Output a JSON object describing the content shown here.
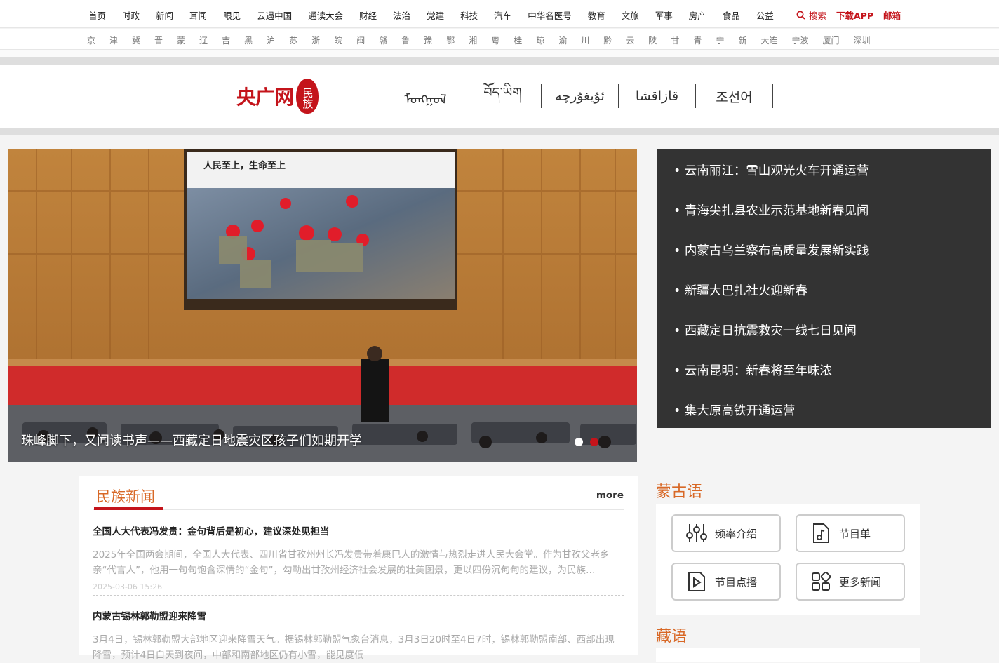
{
  "topnav": {
    "items": [
      "首页",
      "时政",
      "新闻",
      "耳闻",
      "眼见",
      "云遇中国",
      "通读大会",
      "财经",
      "法治",
      "党建",
      "科技",
      "汽车",
      "中华名医号",
      "教育",
      "文旅",
      "军事",
      "房产",
      "食品",
      "公益"
    ],
    "search": "搜索",
    "download": "下载APP",
    "mail": "邮箱"
  },
  "regions": [
    "京",
    "津",
    "冀",
    "晋",
    "蒙",
    "辽",
    "吉",
    "黑",
    "沪",
    "苏",
    "浙",
    "皖",
    "闽",
    "赣",
    "鲁",
    "豫",
    "鄂",
    "湘",
    "粤",
    "桂",
    "琼",
    "渝",
    "川",
    "黔",
    "云",
    "陕",
    "甘",
    "青",
    "宁",
    "新",
    "大连",
    "宁波",
    "厦门",
    "深圳"
  ],
  "brand": {
    "logo_text": "央广网",
    "seal_text": "民族",
    "languages": [
      "ᠮᠣᠩᠭᠣᠯ",
      "བོད་ཡིག",
      "ئۇيغۇرچە",
      "قازاقشا",
      "조선어"
    ]
  },
  "hero": {
    "caption": "珠峰脚下，又闻读书声——西藏定日地震灾区孩子们如期开学",
    "screen_title": "人民至上，生命至上",
    "dots": [
      "#ffffff",
      "#c4141b"
    ]
  },
  "headlines": [
    "• 云南丽江：雪山观光火车开通运营",
    "• 青海尖扎县农业示范基地新春见闻",
    "• 内蒙古乌兰察布高质量发展新实践",
    "• 新疆大巴扎社火迎新春",
    "• 西藏定日抗震救灾一线七日见闻",
    "• 云南昆明：新春将至年味浓",
    "• 集大原高铁开通运营"
  ],
  "minzu_news": {
    "title": "民族新闻",
    "more": "more",
    "items": [
      {
        "headline": "全国人大代表冯发贵：金句背后是初心，建议深处见担当",
        "summary": "2025年全国两会期间，全国人大代表、四川省甘孜州州长冯发贵带着康巴人的激情与热烈走进人民大会堂。作为甘孜父老乡亲“代言人”，他用一句句饱含深情的“金句”，勾勒出甘孜州经济社会发展的壮美图景，更以四份沉甸甸的建议，为民族…",
        "time": "2025-03-06 15:26"
      },
      {
        "headline": "内蒙古锡林郭勒盟迎来降雪",
        "summary": "3月4日，锡林郭勒盟大部地区迎来降雪天气。据锡林郭勒盟气象台消息，3月3日20时至4日7时，锡林郭勒盟南部、西部出现降雪，预计4日白天到夜间，中部和南部地区仍有小雪，能见度低",
        "time": ""
      }
    ]
  },
  "mongol": {
    "title": "蒙古语",
    "buttons": [
      "频率介绍",
      "节目单",
      "节目点播",
      "更多新闻"
    ]
  },
  "tibet": {
    "title": "藏语"
  },
  "colors": {
    "brand_red": "#c4141b",
    "accent_orange": "#d86826",
    "dark_panel": "#333333"
  }
}
